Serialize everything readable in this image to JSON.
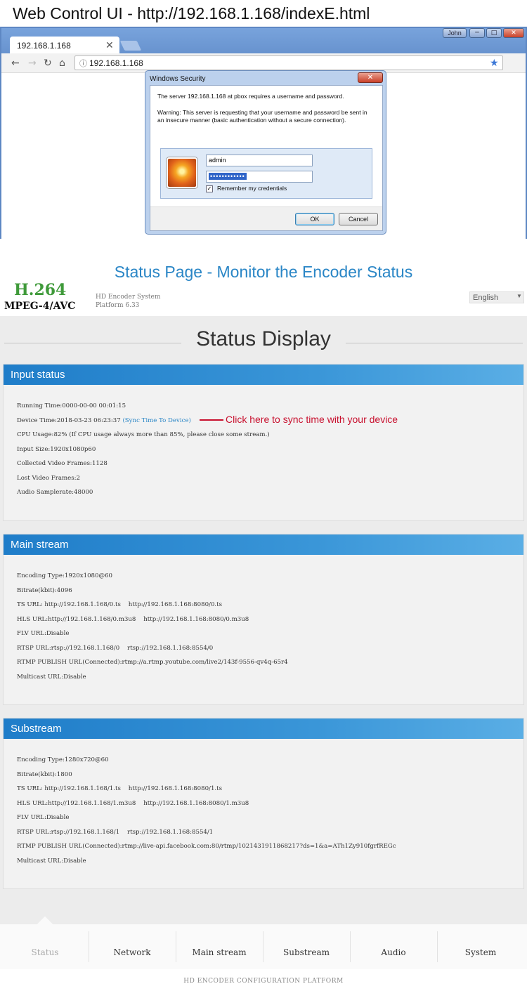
{
  "caption": "Web Control UI - http://192.168.1.168/indexE.html",
  "browser": {
    "tab_title": "192.168.1.168",
    "user_label": "John",
    "url": "192.168.1.168"
  },
  "dialog": {
    "title": "Windows Security",
    "message1": "The server 192.168.1.168 at pbox requires a username and password.",
    "message2": "Warning: This server is requesting that your username and password be sent in an insecure manner (basic authentication without a secure connection).",
    "username": "admin",
    "password_mask": "••••••••••••",
    "remember_label": "Remember my credentials",
    "ok_label": "OK",
    "cancel_label": "Cancel"
  },
  "page_heading": "Status Page - Monitor the Encoder Status",
  "logo": {
    "line1": "H.264",
    "line2": "MPEG-4/AVC"
  },
  "system": {
    "name": "HD Encoder System",
    "platform": "Platform 6.33"
  },
  "language": "English",
  "status_title": "Status Display",
  "input_status": {
    "title": "Input status",
    "running_time": "Running Time:0000-00-00 00:01:15",
    "device_time": "Device Time:2018-03-23 06:23:37",
    "sync_link": "(Sync Time To Device)",
    "cpu_usage": "CPU Usage:82% (If CPU usage always more than 85%, please close some stream.)",
    "input_size": "Input Size:1920x1080p60",
    "collected_frames": "Collected Video Frames:1128",
    "lost_frames": "Lost Video Frames:2",
    "audio_samplerate": "Audio Samplerate:48000"
  },
  "annotation": "Click here to sync time with your device",
  "main_stream": {
    "title": "Main stream",
    "encoding_type": "Encoding Type:1920x1080@60",
    "bitrate": "Bitrate(kbit):4096",
    "ts_url": "TS URL: http://192.168.1.168/0.ts    http://192.168.1.168:8080/0.ts",
    "hls_url": "HLS URL:http://192.168.1.168/0.m3u8    http://192.168.1.168:8080/0.m3u8",
    "flv_url": "FLV URL:Disable",
    "rtsp_url": "RTSP URL:rtsp://192.168.1.168/0    rtsp://192.168.1.168:8554/0",
    "rtmp_publish": "RTMP PUBLISH URL(Connected):rtmp://a.rtmp.youtube.com/live2/143f-9556-qv4q-65r4",
    "multicast": "Multicast URL:Disable"
  },
  "substream": {
    "title": "Substream",
    "encoding_type": "Encoding Type:1280x720@60",
    "bitrate": "Bitrate(kbit):1800",
    "ts_url": "TS URL: http://192.168.1.168/1.ts    http://192.168.1.168:8080/1.ts",
    "hls_url": "HLS URL:http://192.168.1.168/1.m3u8    http://192.168.1.168:8080/1.m3u8",
    "flv_url": "FLV URL:Disable",
    "rtsp_url": "RTSP URL:rtsp://192.168.1.168/1    rtsp://192.168.1.168:8554/1",
    "rtmp_publish": "RTMP PUBLISH URL(Connected):rtmp://live-api.facebook.com:80/rtmp/1021431911868217?ds=1&a=ATh1Zy910fgrfREGc",
    "multicast": "Multicast URL:Disable"
  },
  "nav": [
    "Status",
    "Network",
    "Main stream",
    "Substream",
    "Audio",
    "System"
  ],
  "footer": "HD ENCODER CONFIGURATION PLATFORM"
}
